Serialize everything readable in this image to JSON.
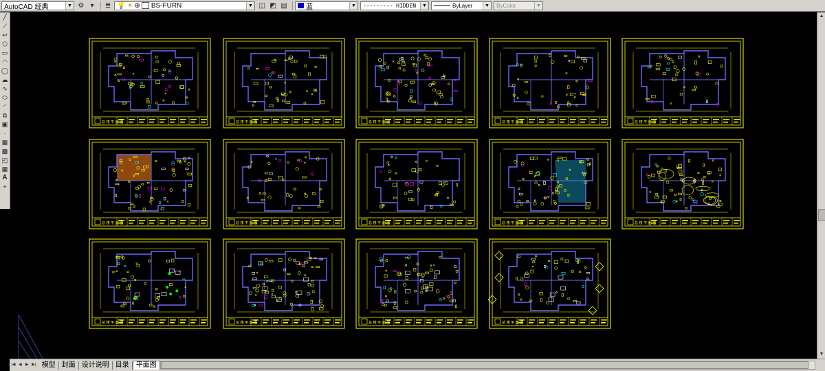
{
  "toolbar": {
    "workspace": "AutoCAD 经典",
    "layer": "BS-FURN",
    "color": "蓝",
    "linetype": "--------- HIDDEN",
    "lineweight": "ByLayer",
    "plotstyle": "ByColor",
    "colors": {
      "layer_swatch": "#ffffff",
      "color_swatch": "#0000cc"
    }
  },
  "tabs": [
    {
      "label": "模型",
      "active": false
    },
    {
      "label": "封面",
      "active": false
    },
    {
      "label": "设计说明",
      "active": false
    },
    {
      "label": "目录",
      "active": false
    },
    {
      "label": "平面图",
      "active": true
    }
  ],
  "tools": [
    "line-icon",
    "construction-line-icon",
    "polyline-icon",
    "polygon-icon",
    "rectangle-icon",
    "arc-icon",
    "circle-icon",
    "revision-cloud-icon",
    "spline-icon",
    "ellipse-icon",
    "ellipse-arc-icon",
    "insert-block-icon",
    "make-block-icon",
    "point-icon",
    "hatch-icon",
    "gradient-icon",
    "region-icon",
    "table-icon",
    "multiline-text-icon",
    "add-selected-icon"
  ],
  "sheets": {
    "count": 14,
    "title_text": "总 楼 平 面 图",
    "colors": {
      "frame": "#ffff00",
      "wall": "#6a6aff",
      "detail": "#ffff00",
      "accent_cyan": "#00ffff",
      "accent_magenta": "#ff00ff",
      "accent_orange": "#ff8c1a",
      "accent_green": "#00ff00",
      "accent_white": "#ffffff",
      "floor_fill": "#0a4a5a",
      "orange_fill": "#b35a10"
    }
  }
}
